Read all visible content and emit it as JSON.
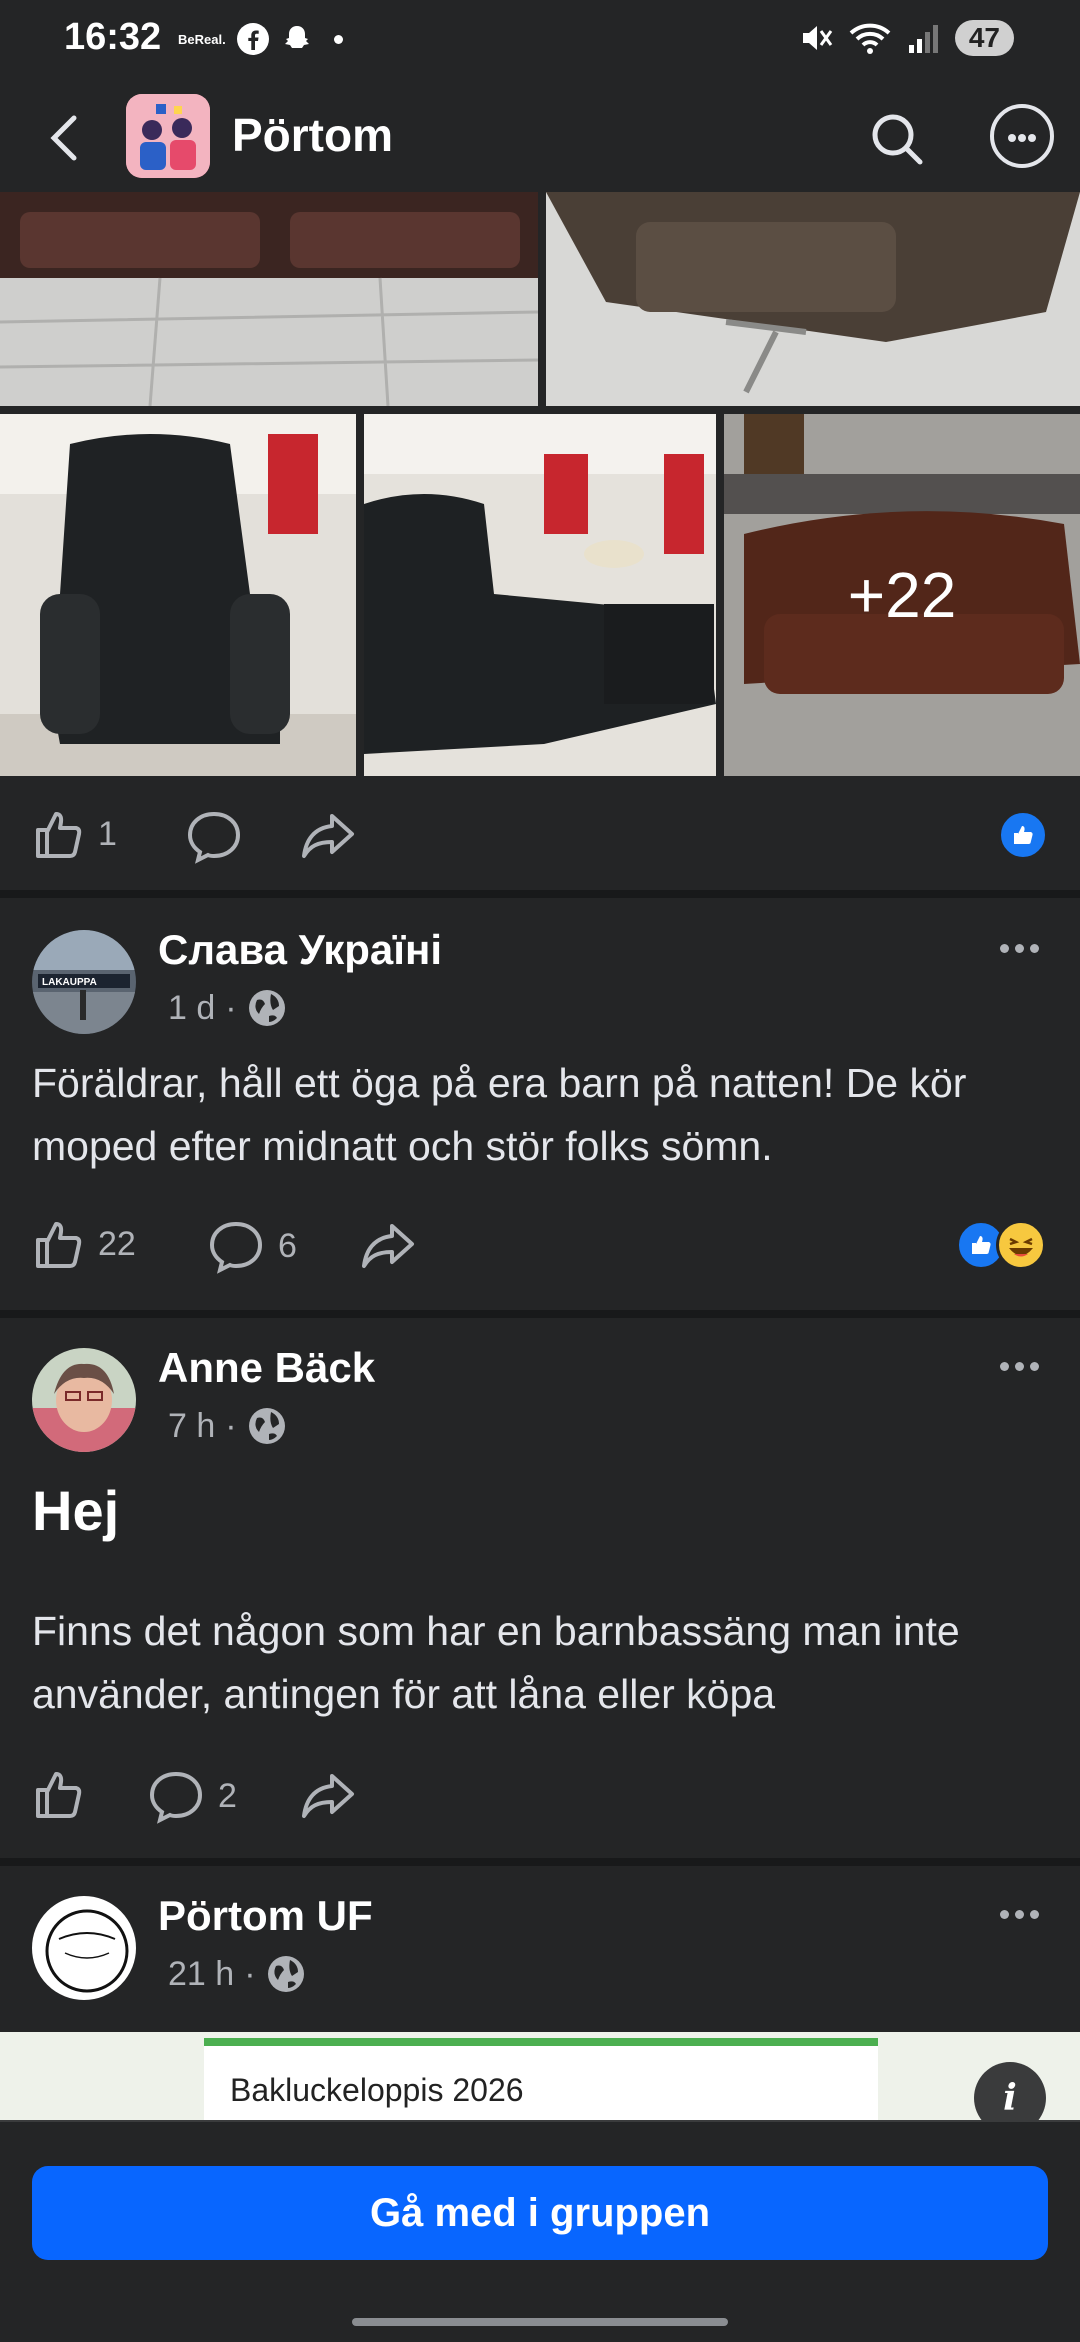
{
  "status_bar": {
    "time": "16:32",
    "app_label": "BeReal.",
    "battery": "47"
  },
  "header": {
    "title": "Pörtom"
  },
  "photo_grid": {
    "more_count": "+22"
  },
  "post_actions_first": {
    "like_count": "1"
  },
  "posts": [
    {
      "author": "Слава Україні",
      "time": "1 d",
      "text": "Föräldrar, håll ett öga på era barn på natten! De kör moped efter midnatt och stör folks sömn.",
      "like_count": "22",
      "comment_count": "6"
    },
    {
      "author": "Anne Bäck",
      "time": "7 h",
      "heading": "Hej",
      "text": "Finns det någon som har en barnbassäng man inte använder, antingen för att låna eller köpa",
      "like_count": "",
      "comment_count": "2"
    },
    {
      "author": "Pörtom UF",
      "time": "21 h",
      "preview_text": "Bakluckeloppis 2026"
    }
  ],
  "join": {
    "label": "Gå med i gruppen"
  },
  "colors": {
    "background": "#242526",
    "divider": "#18191a",
    "accent": "#0866ff",
    "like_blue": "#1877f2"
  }
}
